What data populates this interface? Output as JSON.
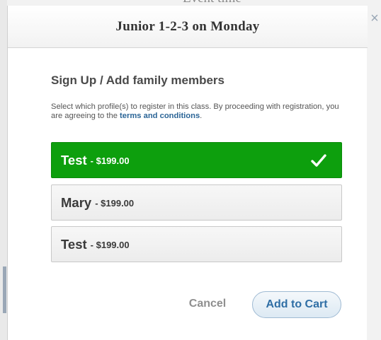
{
  "background": {
    "peek_text": "Event time"
  },
  "modal": {
    "title": "Junior 1-2-3 on Monday",
    "close_glyph": "×",
    "heading": "Sign Up / Add family members",
    "description_prefix": "Select which profile(s) to register in this class. By proceeding with registration, you are agreeing to the ",
    "terms_link": "terms and conditions",
    "description_suffix": ".",
    "profiles": [
      {
        "name": "Test",
        "price": "- $199.00",
        "selected": true
      },
      {
        "name": "Mary",
        "price": "- $199.00",
        "selected": false
      },
      {
        "name": "Test",
        "price": "- $199.00",
        "selected": false
      }
    ],
    "cancel_label": "Cancel",
    "add_to_cart_label": "Add to Cart"
  },
  "colors": {
    "selected_green": "#0d9f0d",
    "link_blue": "#2a6496",
    "button_blue": "#2f6ea5"
  },
  "icons": {
    "selected_mark": "check-icon",
    "close": "close-icon"
  }
}
